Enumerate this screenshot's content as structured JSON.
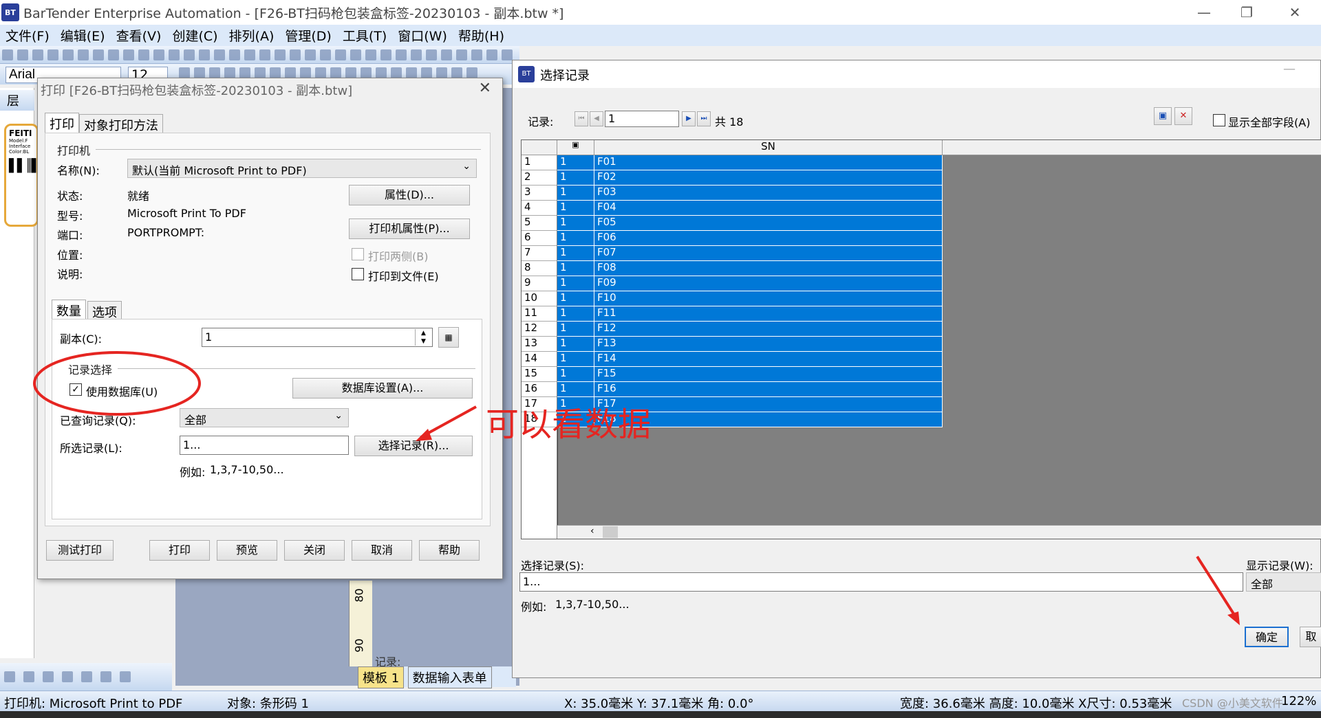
{
  "app": {
    "title": "BarTender Enterprise Automation - [F26-BT扫码枪包装盒标签-20230103 - 副本.btw *]",
    "logo_text": "BT"
  },
  "menu": [
    "文件(F)",
    "编辑(E)",
    "查看(V)",
    "创建(C)",
    "排列(A)",
    "管理(D)",
    "工具(T)",
    "窗口(W)",
    "帮助(H)"
  ],
  "toolbar": {
    "font": "Arial",
    "size": "12"
  },
  "left_pane": {
    "header": "层",
    "thumb_text": "FEITI",
    "thumb_lines": [
      "Model:F",
      "Interface",
      "Color:BL"
    ]
  },
  "doc_tabs": [
    "模板 1",
    "数据输入表单"
  ],
  "ruler_marks": [
    "80",
    "90"
  ],
  "record_nav_label": "记录:",
  "status": {
    "printer": "打印机: Microsoft Print to PDF",
    "object": "对象: 条形码 1",
    "position": "X: 35.0毫米  Y: 37.1毫米  角: 0.0°",
    "size": "宽度: 36.6毫米  高度: 10.0毫米  X尺寸: 0.53毫米",
    "zoom": "122%",
    "watermark": "CSDN @小美文软件"
  },
  "print_dialog": {
    "title": "打印 [F26-BT扫码枪包装盒标签-20230103 - 副本.btw]",
    "tabs": [
      "打印",
      "对象打印方法"
    ],
    "printer_group": "打印机",
    "name_label": "名称(N):",
    "name_value": "默认(当前 Microsoft Print to PDF)",
    "status_label": "状态:",
    "status_value": "就绪",
    "model_label": "型号:",
    "model_value": "Microsoft Print To PDF",
    "port_label": "端口:",
    "port_value": "PORTPROMPT:",
    "location_label": "位置:",
    "comment_label": "说明:",
    "properties_btn": "属性(D)...",
    "printer_props_btn": "打印机属性(P)...",
    "duplex_label": "打印两侧(B)",
    "print_to_file_label": "打印到文件(E)",
    "sub_tabs": [
      "数量",
      "选项"
    ],
    "copies_label": "副本(C):",
    "copies_value": "1",
    "record_selection_group": "记录选择",
    "use_database_label": "使用数据库(U)",
    "use_database_checked": true,
    "db_settings_btn": "数据库设置(A)...",
    "queried_label": "已查询记录(Q):",
    "queried_value": "全部",
    "selected_label": "所选记录(L):",
    "selected_value": "1...",
    "select_records_btn": "选择记录(R)...",
    "example_label": "例如:",
    "example_value": "1,3,7-10,50...",
    "buttons": [
      "测试打印",
      "打印",
      "预览",
      "关闭",
      "取消",
      "帮助"
    ]
  },
  "select_dialog": {
    "title": "选择记录",
    "records_label": "记录:",
    "current_record": "1",
    "total_label": "共 18",
    "show_all_fields_label": "显示全部字段(A)",
    "column_header": "SN",
    "rows": [
      {
        "n": "1",
        "flag": "1",
        "sn": "F01"
      },
      {
        "n": "2",
        "flag": "1",
        "sn": "F02"
      },
      {
        "n": "3",
        "flag": "1",
        "sn": "F03"
      },
      {
        "n": "4",
        "flag": "1",
        "sn": "F04"
      },
      {
        "n": "5",
        "flag": "1",
        "sn": "F05"
      },
      {
        "n": "6",
        "flag": "1",
        "sn": "F06"
      },
      {
        "n": "7",
        "flag": "1",
        "sn": "F07"
      },
      {
        "n": "8",
        "flag": "1",
        "sn": "F08"
      },
      {
        "n": "9",
        "flag": "1",
        "sn": "F09"
      },
      {
        "n": "10",
        "flag": "1",
        "sn": "F10"
      },
      {
        "n": "11",
        "flag": "1",
        "sn": "F11"
      },
      {
        "n": "12",
        "flag": "1",
        "sn": "F12"
      },
      {
        "n": "13",
        "flag": "1",
        "sn": "F13"
      },
      {
        "n": "14",
        "flag": "1",
        "sn": "F14"
      },
      {
        "n": "15",
        "flag": "1",
        "sn": "F15"
      },
      {
        "n": "16",
        "flag": "1",
        "sn": "F16"
      },
      {
        "n": "17",
        "flag": "1",
        "sn": "F17"
      },
      {
        "n": "18",
        "flag": "1",
        "sn": "F18"
      }
    ],
    "select_label": "选择记录(S):",
    "select_value": "1...",
    "example_label": "例如:",
    "example_value": "1,3,7-10,50...",
    "show_label": "显示记录(W):",
    "show_value": "全部",
    "ok_btn": "确定",
    "cancel_btn": "取"
  },
  "annotation": {
    "text": "可以看数据",
    "color": "#e52521"
  }
}
